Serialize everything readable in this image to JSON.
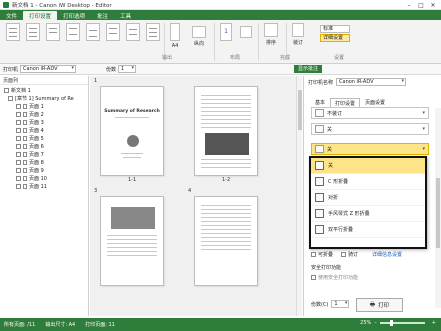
{
  "window": {
    "title": "新文档 1 - Canon iW Desktop - Editor"
  },
  "menu": {
    "tabs": [
      "文件",
      "打印设置",
      "打印选项",
      "批注",
      "工具"
    ],
    "active_index": 1
  },
  "ribbon": {
    "layout_label": "布局",
    "output_label": "输出",
    "collate_label": "排序",
    "nup_value": "1",
    "paper_label": "A4",
    "direction_label": "纵向",
    "staple_label": "装订",
    "layout_group": "布局",
    "finishing_group": "完成",
    "output_group": "输出",
    "settings_group": "设置",
    "opt1": "标准",
    "opt2": "详细设置"
  },
  "toolbar2": {
    "printer_label": "打印机",
    "printer_value": "Canon iR-ADV",
    "copies_label": "份数",
    "copies_value": "1",
    "show_settings": "显示批注"
  },
  "left_pane": {
    "title": "页面列",
    "tree": [
      {
        "label": "新文档 1",
        "level": 0
      },
      {
        "label": "[章节 1] Summary of Re",
        "level": 1
      },
      {
        "label": "页面 1",
        "level": 2
      },
      {
        "label": "页面 2",
        "level": 2
      },
      {
        "label": "页面 3",
        "level": 2
      },
      {
        "label": "页面 4",
        "level": 2
      },
      {
        "label": "页面 5",
        "level": 2
      },
      {
        "label": "页面 6",
        "level": 2
      },
      {
        "label": "页面 7",
        "level": 2
      },
      {
        "label": "页面 8",
        "level": 2
      },
      {
        "label": "页面 9",
        "level": 2
      },
      {
        "label": "页面 10",
        "level": 2
      },
      {
        "label": "页面 11",
        "level": 2
      }
    ]
  },
  "pages": [
    {
      "num": "1",
      "caption": "1-1",
      "title": "Summary of Research"
    },
    {
      "num": "",
      "caption": "1-2",
      "title": ""
    },
    {
      "num": "3",
      "caption": "",
      "title": ""
    },
    {
      "num": "4",
      "caption": "",
      "title": ""
    }
  ],
  "right_pane": {
    "printer_label": "打印机名称",
    "printer_value": "Canon iR-ADV",
    "tabs": [
      "基本",
      "打印设置",
      "页面设置"
    ],
    "dd1": "不装订",
    "dd2": "关",
    "dd3": "关",
    "options": [
      "关",
      "C 形折叠",
      "对折",
      "手风琴式 Z 形折叠",
      "双平行折叠"
    ],
    "active_option": 0,
    "chk1": "可折叠",
    "chk2": "骑订",
    "link": "详细信息设置",
    "secure_label": "安全打印功能",
    "secure_sub": "使用安全打印功能",
    "copies_label": "份数(C)",
    "copies_value": "1",
    "print_btn": "打印"
  },
  "status": {
    "total_pages": "所有页面: /11",
    "paper": "输出尺寸: A4",
    "sheets": "打印页面: 11",
    "zoom": "25%"
  }
}
